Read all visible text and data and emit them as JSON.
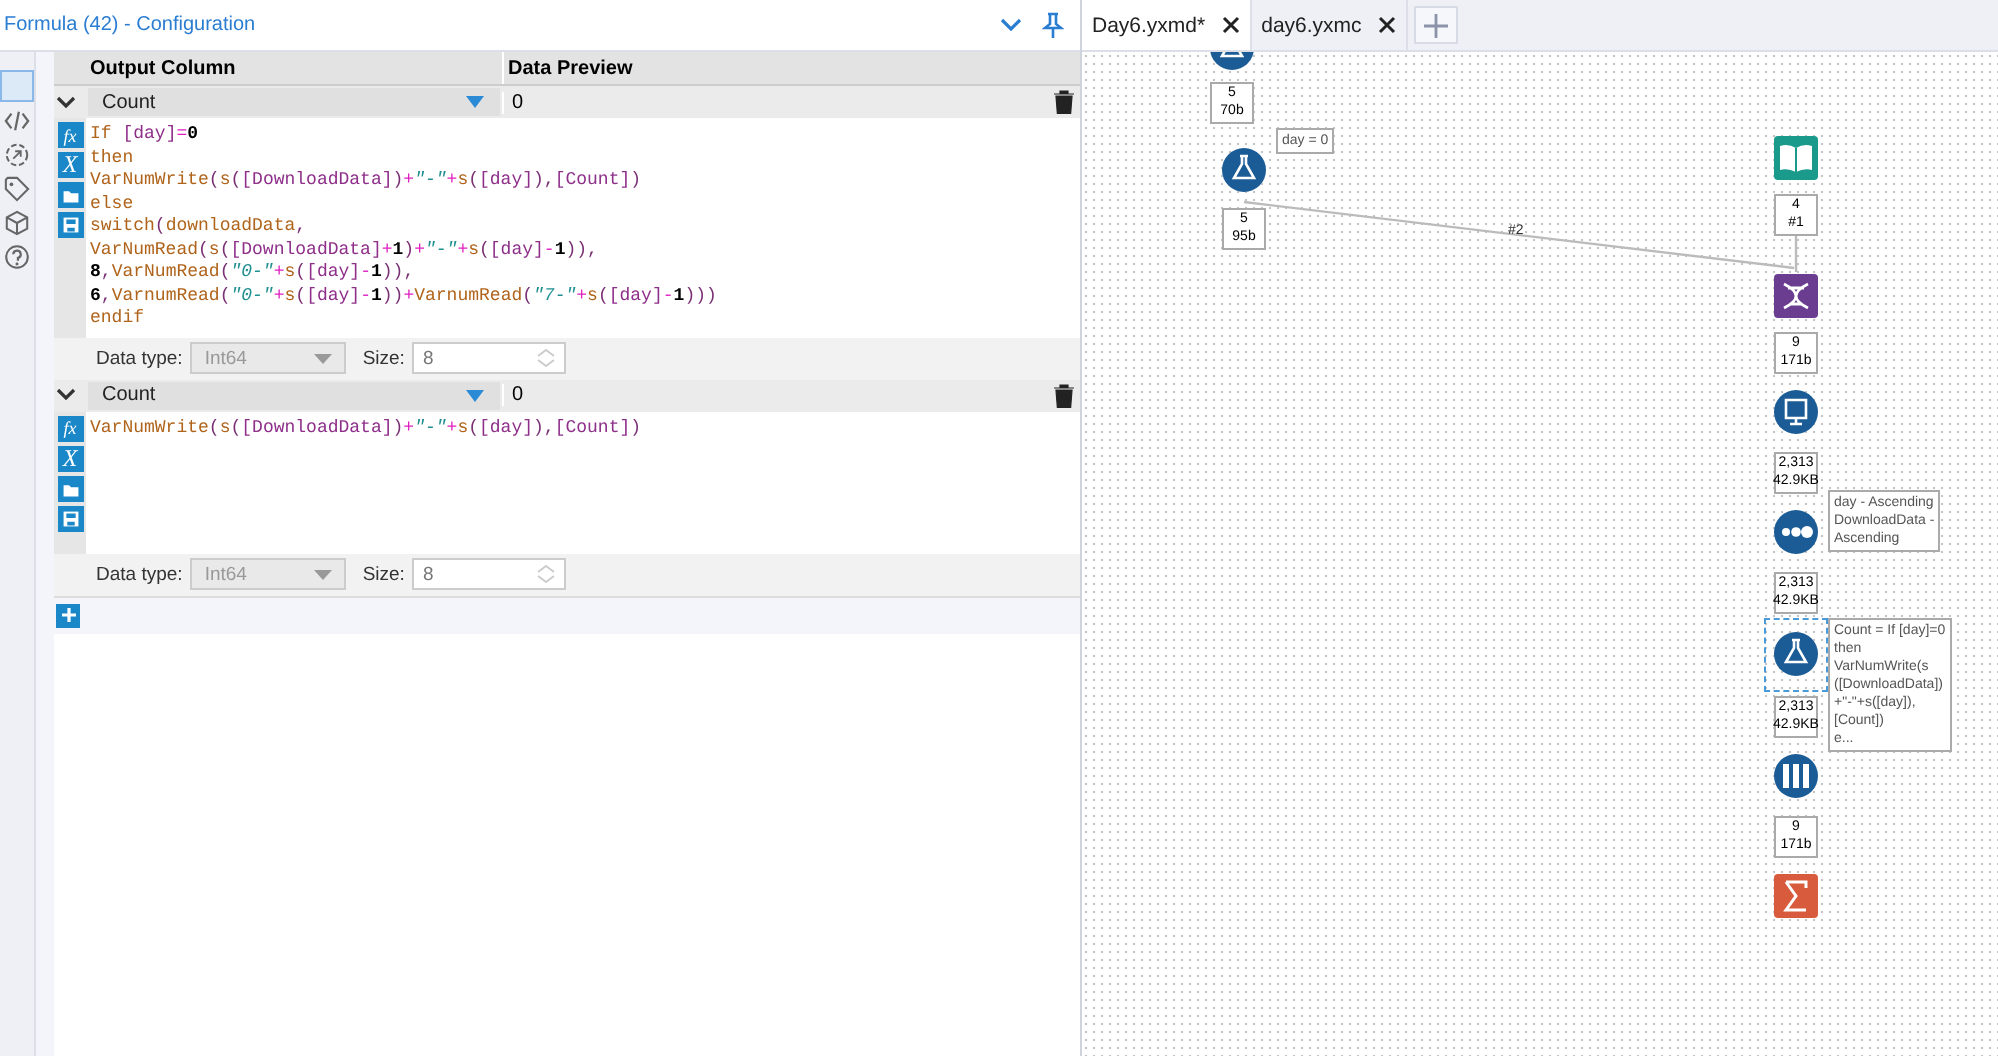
{
  "panel": {
    "title": "Formula (42) - Configuration"
  },
  "table": {
    "columns": [
      "Output Column",
      "Data Preview"
    ],
    "rows": [
      {
        "column": "Count",
        "preview": "0",
        "expanded": true,
        "function_button": "fx",
        "variable_button": "X",
        "expression": [
          "If [day]=0",
          "then",
          "VarNumWrite(s([DownloadData])+\"-\"+s([day]),[Count])",
          "else",
          "switch(downloadData,",
          "VarNumRead(s([DownloadData]+1)+\"-\"+s([day]-1)),",
          "8,VarNumRead(\"0-\"+s([day]-1)),",
          "6,VarnumRead(\"0-\"+s([day]-1))+VarnumRead(\"7-\"+s([day]-1)))",
          "endif"
        ],
        "data_type_label": "Data type:",
        "data_type": "Int64",
        "size_label": "Size:",
        "size": "8"
      },
      {
        "column": "Count",
        "preview": "0",
        "expanded": true,
        "function_button": "fx",
        "variable_button": "X",
        "expression": [
          "VarNumWrite(s([DownloadData])+\"-\"+s([day]),[Count])"
        ],
        "data_type_label": "Data type:",
        "data_type": "Int64",
        "size_label": "Size:",
        "size": "8"
      }
    ]
  },
  "tabs": [
    {
      "label": "Day6.yxmd*",
      "selected": true
    },
    {
      "label": "day6.yxmc",
      "selected": false
    }
  ],
  "canvas": {
    "nodes": [
      {
        "kind": "flask",
        "count": [
          "5",
          "70b"
        ],
        "selected": false
      },
      {
        "kind": "flask",
        "count": [
          "5",
          "95b"
        ],
        "annotation": [
          "day = 0"
        ],
        "selected": false
      },
      {
        "kind": "book",
        "count": [
          "4",
          "#1"
        ],
        "selected": false
      },
      {
        "kind": "helix",
        "count": [
          "9",
          "171b"
        ],
        "selected": false
      },
      {
        "kind": "document",
        "count": [
          "2,313",
          "42.9KB"
        ],
        "selected": false
      },
      {
        "kind": "dots",
        "count": [
          "2,313",
          "42.9KB"
        ],
        "annotation": [
          "day - Ascending",
          "DownloadData -",
          "Ascending"
        ],
        "selected": false
      },
      {
        "kind": "flask",
        "count": [
          "2,313",
          "42.9KB"
        ],
        "annotation": [
          "Count = If [day]=0",
          "then",
          "VarNumWrite(s",
          "([DownloadData])",
          "+\"-\"+s([day]),",
          "[Count])",
          "e..."
        ],
        "selected": true
      },
      {
        "kind": "columns",
        "count": [
          "9",
          "171b"
        ],
        "selected": false
      },
      {
        "kind": "sigma",
        "selected": false
      }
    ],
    "connection_label": "#2"
  }
}
